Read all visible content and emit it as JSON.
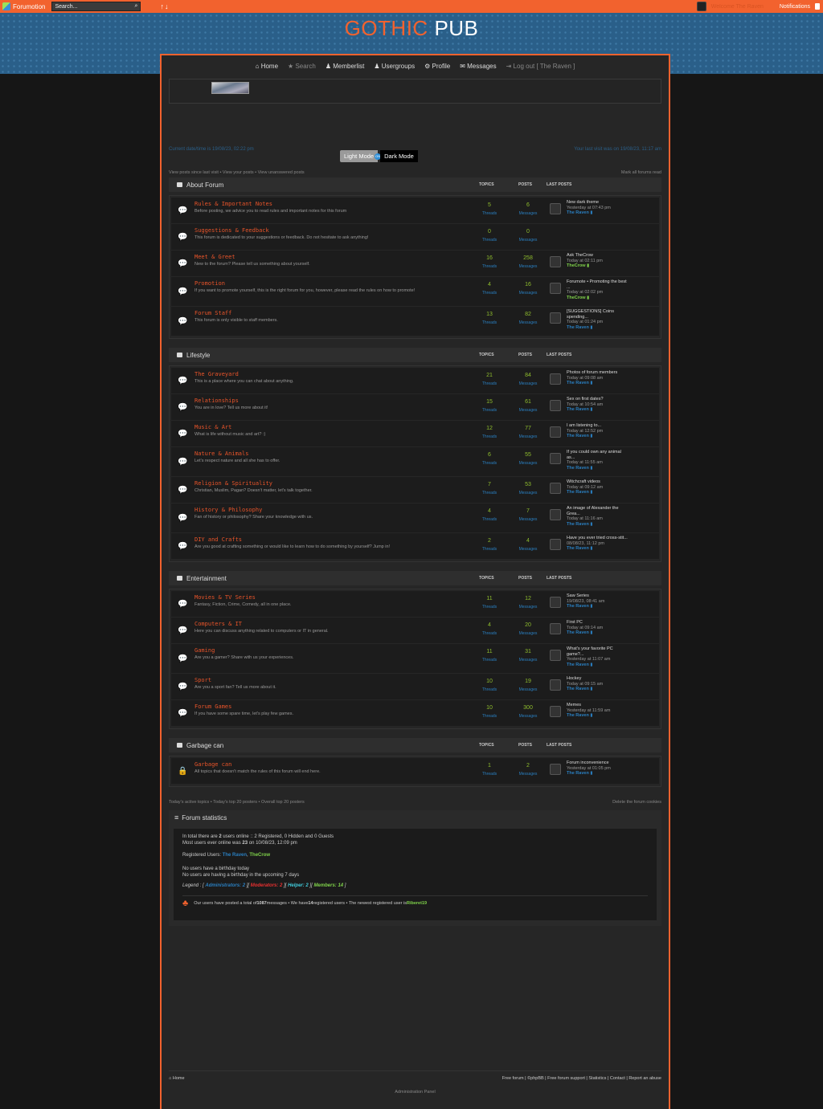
{
  "topbar": {
    "brand": "Forumotion",
    "search_placeholder": "Search...",
    "arrows": "↑↓",
    "welcome": "Welcome The Raven",
    "notifications": "Notifications"
  },
  "site": {
    "title_accent": "GOTHIC",
    "title_rest": "PUB"
  },
  "nav": [
    {
      "label": "Home",
      "icon": "⌂",
      "dim": false
    },
    {
      "label": "Search",
      "icon": "★",
      "dim": true
    },
    {
      "label": "Memberlist",
      "icon": "♟",
      "dim": false
    },
    {
      "label": "Usergroups",
      "icon": "♟",
      "dim": false
    },
    {
      "label": "Profile",
      "icon": "⚙",
      "dim": false
    },
    {
      "label": "Messages",
      "icon": "✉",
      "dim": false
    },
    {
      "label": "Log out [ The Raven ]",
      "icon": "⇥",
      "dim": true
    }
  ],
  "info": {
    "current": "Current date/time is 19/08/23, 02:22 pm",
    "last_visit": "Your last visit was on 19/08/23, 11:17 am",
    "light": "Light Mode",
    "dot": "ON",
    "dark": "Dark Mode",
    "links_left": "View posts since last visit • View your posts • View unanswered posts",
    "links_right": "Mark all forums read"
  },
  "cols": {
    "topics": "TOPICS",
    "posts": "POSTS",
    "last": "LAST POSTS",
    "threads": "Threads",
    "messages": "Messages"
  },
  "categories": [
    {
      "name": "About Forum",
      "forums": [
        {
          "title": "Rules & Important Notes",
          "desc": "Before posting, we advice you to read rules and important notes for this forum",
          "topics": "5",
          "posts": "6",
          "lp": [
            "New dark theme"
          ],
          "lp_date": "Yesterday at 07:43 pm",
          "lp_user": "The Raven",
          "ucls": "u"
        },
        {
          "title": "Suggestions & Feedback",
          "desc": "This forum is dedicated to your suggestions or feedback. Do not hesitate to ask anything!",
          "topics": "0",
          "posts": "0",
          "lp": [],
          "lp_date": "",
          "lp_user": "",
          "ucls": "u"
        },
        {
          "title": "Meet & Greet",
          "desc": "New to the forum? Please tell us something about yourself.",
          "topics": "16",
          "posts": "258",
          "lp": [
            "Ask TheCrow"
          ],
          "lp_date": "Today at 02:11 pm",
          "lp_user": "TheCrow",
          "ucls": "u2"
        },
        {
          "title": "Promotion",
          "desc": "If you want to promote yourself, this is the right forum for you, however, please read the rules on how to promote!",
          "topics": "4",
          "posts": "16",
          "lp": [
            "Forumote • Promoting the best",
            "..."
          ],
          "lp_date": "Today at 02:02 pm",
          "lp_user": "TheCrow",
          "ucls": "u2"
        },
        {
          "title": "Forum Staff",
          "desc": "This forum is only visible to staff members.",
          "topics": "13",
          "posts": "82",
          "lp": [
            "[SUGGESTIONS] Coins",
            "spending..."
          ],
          "lp_date": "Today at 01:24 pm",
          "lp_user": "The Raven",
          "ucls": "u"
        }
      ]
    },
    {
      "name": "Lifestyle",
      "forums": [
        {
          "title": "The Graveyard",
          "desc": "This is a place where you can chat about anything.",
          "topics": "21",
          "posts": "84",
          "lp": [
            "Photos of forum members"
          ],
          "lp_date": "Today at 09:08 am",
          "lp_user": "The Raven",
          "ucls": "u"
        },
        {
          "title": "Relationships",
          "desc": "You are in love? Tell us more about it!",
          "topics": "15",
          "posts": "61",
          "lp": [
            "Sex on first dates?"
          ],
          "lp_date": "Today at 10:54 am",
          "lp_user": "The Raven",
          "ucls": "u"
        },
        {
          "title": "Music & Art",
          "desc": "What is life without music and art? :)",
          "topics": "12",
          "posts": "77",
          "lp": [
            "I am listening to..."
          ],
          "lp_date": "Today at 12:52 pm",
          "lp_user": "The Raven",
          "ucls": "u"
        },
        {
          "title": "Nature & Animals",
          "desc": "Let's respect nature and all she has to offer.",
          "topics": "6",
          "posts": "55",
          "lp": [
            "If you could own any animal",
            "as..."
          ],
          "lp_date": "Today at 11:55 am",
          "lp_user": "The Raven",
          "ucls": "u"
        },
        {
          "title": "Religion & Spirituality",
          "desc": "Christian, Muslim, Pagan? Doesn't matter, let's talk together.",
          "topics": "7",
          "posts": "53",
          "lp": [
            "Witchcraft videos"
          ],
          "lp_date": "Today at 09:12 am",
          "lp_user": "The Raven",
          "ucls": "u"
        },
        {
          "title": "History & Philosophy",
          "desc": "Fan of history or philosophy? Share your knowledge with us.",
          "topics": "4",
          "posts": "7",
          "lp": [
            "An image of Alexander the",
            "Grea..."
          ],
          "lp_date": "Today at 11:16 am",
          "lp_user": "The Raven",
          "ucls": "u"
        },
        {
          "title": "DIY and Crafts",
          "desc": "Are you good at crafting something or would like to learn how to do something by yourself? Jump in!",
          "topics": "2",
          "posts": "4",
          "lp": [
            "Have you ever tried cross-stit..."
          ],
          "lp_date": "08/08/23, 11:12 pm",
          "lp_user": "The Raven",
          "ucls": "u"
        }
      ]
    },
    {
      "name": "Entertainment",
      "forums": [
        {
          "title": "Movies & TV Series",
          "desc": "Fantasy, Fiction, Crime, Comedy, all in one place.",
          "topics": "11",
          "posts": "12",
          "lp": [
            "Saw Series"
          ],
          "lp_date": "19/08/23, 08:41 am",
          "lp_user": "The Raven",
          "ucls": "u"
        },
        {
          "title": "Computers & IT",
          "desc": "Here you can discuss anything related to computers or IT in general.",
          "topics": "4",
          "posts": "20",
          "lp": [
            "First PC"
          ],
          "lp_date": "Today at 09:14 am",
          "lp_user": "The Raven",
          "ucls": "u"
        },
        {
          "title": "Gaming",
          "desc": "Are you a gamer? Share with us your experiences.",
          "topics": "11",
          "posts": "31",
          "lp": [
            "What's your favorite PC",
            "game?..."
          ],
          "lp_date": "Yesterday at 11:07 am",
          "lp_user": "The Raven",
          "ucls": "u"
        },
        {
          "title": "Sport",
          "desc": "Are you a sport fan? Tell us more about it.",
          "topics": "10",
          "posts": "19",
          "lp": [
            "Hockey"
          ],
          "lp_date": "Today at 09:15 am",
          "lp_user": "The Raven",
          "ucls": "u"
        },
        {
          "title": "Forum Games",
          "desc": "If you have some spare time, let's play few games.",
          "topics": "10",
          "posts": "300",
          "lp": [
            "Memes"
          ],
          "lp_date": "Yesterday at 11:59 am",
          "lp_user": "The Raven",
          "ucls": "u"
        }
      ]
    },
    {
      "name": "Garbage can",
      "forums": [
        {
          "title": "Garbage can",
          "desc": "All topics that doesn't match the rules of this forum will end here.",
          "topics": "1",
          "posts": "2",
          "lp": [
            "Forum inconvenience"
          ],
          "lp_date": "Yesterday at 01:05 pm",
          "lp_user": "The Raven",
          "ucls": "u",
          "locked": true
        }
      ]
    }
  ],
  "bottom_links": {
    "left": "Today's active topics • Today's top 20 posters • Overall top 20 posters",
    "right": "Delete the forum cookies"
  },
  "stats": {
    "title": "Forum statistics",
    "online_a": "In total there are ",
    "online_n": "2",
    "online_b": " users online :: 2 Registered, 0 Hidden and 0 Guests",
    "most_a": "Most users ever online was ",
    "most_n": "23",
    "most_b": " on 10/08/23, 12:09 pm",
    "registered_label": "Registered Users: ",
    "reg_user1": "The Raven",
    "reg_sep": ", ",
    "reg_user2": "TheCrow",
    "birthday1": "No users have a birthday today",
    "birthday2": "No users are having a birthday in the upcoming 7 days",
    "legend_label": "Legend : [ ",
    "leg_admin": "Administrators: 2",
    "leg_sep1": " ][ ",
    "leg_mod": "Moderators: 2",
    "leg_sep2": " ][ ",
    "leg_help": "Helper: 2",
    "leg_sep3": " ][ ",
    "leg_mem": "Members: 14",
    "leg_end": " ]",
    "total_a": "Our users have posted a total of ",
    "total_n": "1087",
    "total_b": " messages • We have ",
    "total_reg": "14",
    "total_c": " registered users • The newest registered user is ",
    "newest": "Riberet19"
  },
  "footer": {
    "home": "Home",
    "links": "Free forum | ©phpBB | Free forum support | Statistics | Contact | Report an abuse",
    "admin": "Administration Panel"
  }
}
